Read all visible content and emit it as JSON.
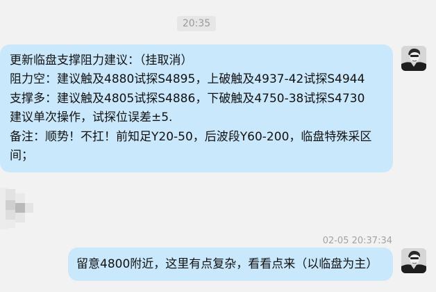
{
  "chat": {
    "time_divider": "20:35",
    "messages": [
      {
        "lines": [
          "更新临盘支撑阻力建议：（挂取消）",
          "阻力空：建议触及4880试探S4895，上破触及4937-42试探S4944",
          "支撑多：建议触及4805试探S4886，下破触及4750-38试探S4730",
          "建议单次操作，试探位误差±5.",
          "备注：顺势！不扛！前知足Y20-50，后波段Y60-200，临盘特殊采区",
          "间；"
        ]
      },
      {
        "timestamp": "02-05 20:37:34",
        "text": "留意4800附近，这里有点复杂，看看点来（以临盘为主）"
      }
    ]
  },
  "colors": {
    "background": "#f2f2f2",
    "bubble": "#c9e8fb",
    "timestamp_text": "#9a9a9a"
  },
  "icons": {
    "user_avatar": "person-avatar",
    "other_avatar": "blurred-avatar"
  }
}
